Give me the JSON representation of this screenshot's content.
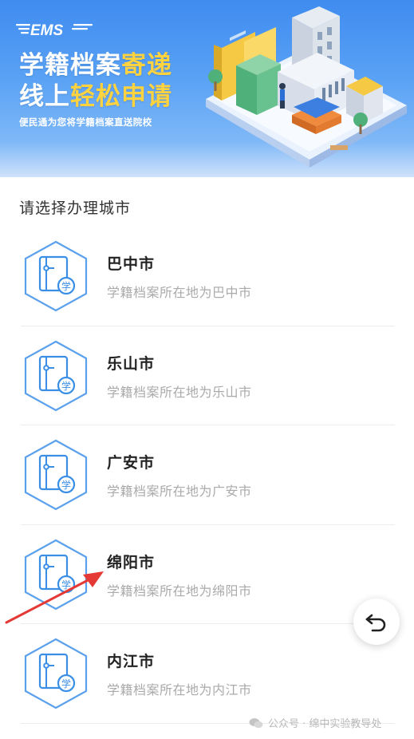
{
  "banner": {
    "logo_text": "EMS",
    "title_line1_white": "学籍档案",
    "title_line1_yellow": "寄递",
    "title_line2_white1": "线上",
    "title_line2_yellow": "轻松申请",
    "subtitle": "便民通为您将学籍档案直送院校",
    "colors": {
      "bg": "#4a95f2",
      "highlight": "#ffd23f"
    }
  },
  "section_title": "请选择办理城市",
  "cities": [
    {
      "name": "巴中市",
      "desc": "学籍档案所在地为巴中市",
      "icon": "archive-folder-icon",
      "badge": "学"
    },
    {
      "name": "乐山市",
      "desc": "学籍档案所在地为乐山市",
      "icon": "archive-folder-icon",
      "badge": "学"
    },
    {
      "name": "广安市",
      "desc": "学籍档案所在地为广安市",
      "icon": "archive-folder-icon",
      "badge": "学"
    },
    {
      "name": "绵阳市",
      "desc": "学籍档案所在地为绵阳市",
      "icon": "archive-folder-icon",
      "badge": "学"
    },
    {
      "name": "内江市",
      "desc": "学籍档案所在地为内江市",
      "icon": "archive-folder-icon",
      "badge": "学"
    }
  ],
  "fab": {
    "icon": "undo-arrow-icon"
  },
  "watermark": {
    "icon": "wechat-icon",
    "text": "公众号 · 绵中实验教导处"
  },
  "accent_color": "#3a8ee6",
  "annotation_color": "#e53935"
}
